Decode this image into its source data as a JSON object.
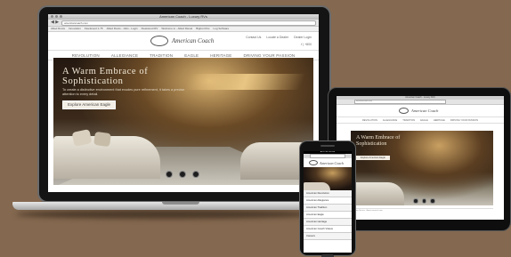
{
  "laptop": {
    "window_title": "American Coach - Luxury RVs",
    "url": "americancoach.com",
    "nav_arrows": "◀ ▶",
    "bookmarks": [
      "Allied Roots",
      "Innovation",
      "Fleetwood 1-75",
      "Allied Roots - Jobs - Login",
      "Fleetwood RV",
      "Welcome to - Allied Diesel",
      "Bigfoot Rvs",
      "Log Software"
    ],
    "logo_text": "American Coach",
    "header_links": [
      "Contact Us",
      "Locate a Dealer",
      "Dealer Login"
    ],
    "phone_text": "f | +800",
    "nav_items": [
      "REVOLUTION",
      "ALLEGIANCE",
      "TRADITION",
      "EAGLE",
      "HERITAGE",
      "DRIVING YOUR PASSION"
    ],
    "hero": {
      "title_line1": "A Warm Embrace of",
      "title_line2": "Sophistication",
      "subtitle": "To create a distinctive environment that exudes pure refinement, it takes a precise attention to every detail.",
      "button_label": "Explore American Eagle"
    }
  },
  "tablet": {
    "window_title": "American Coach - Luxury RVs",
    "url": "americancoach.com",
    "logo_text": "American Coach",
    "nav_items": [
      "REVOLUTION",
      "ALLEGIANCE",
      "TRADITION",
      "EAGLE",
      "HERITAGE",
      "DRIVING YOUR PASSION"
    ],
    "hero_title_line1": "A Warm Embrace of",
    "hero_title_line2": "Sophistication",
    "button_label": "Explore American Eagle",
    "footer_text": "Customer Service · Americancoach.com"
  },
  "phone": {
    "status_text": "AT&T 3G 2:43 PM",
    "logo_text": "American Coach",
    "menu_items": [
      "American Revolution",
      "American Allegiance",
      "American Tradition",
      "American Eagle",
      "American Heritage",
      "American Coach Videos",
      "Careers"
    ]
  },
  "colors": {
    "background": "#84684f",
    "hero_gold": "#d9b270"
  }
}
